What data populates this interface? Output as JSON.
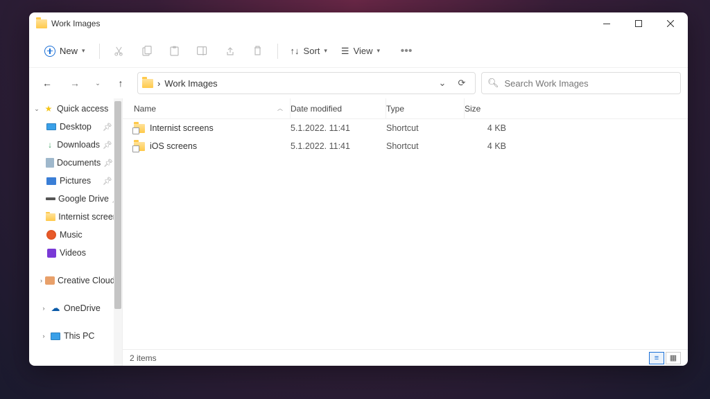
{
  "window": {
    "title": "Work Images"
  },
  "toolbar": {
    "new_label": "New",
    "sort_label": "Sort",
    "view_label": "View"
  },
  "address": {
    "path": "Work Images",
    "sep": "›"
  },
  "search": {
    "placeholder": "Search Work Images"
  },
  "sidebar": {
    "quick_access": "Quick access",
    "items": [
      {
        "label": "Desktop",
        "pinned": true
      },
      {
        "label": "Downloads",
        "pinned": true
      },
      {
        "label": "Documents",
        "pinned": true
      },
      {
        "label": "Pictures",
        "pinned": true
      },
      {
        "label": "Google Drive",
        "pinned": true
      },
      {
        "label": "Internist screens",
        "pinned": false
      },
      {
        "label": "Music",
        "pinned": false
      },
      {
        "label": "Videos",
        "pinned": false
      }
    ],
    "creative_cloud": "Creative Cloud Files",
    "onedrive": "OneDrive",
    "this_pc": "This PC"
  },
  "columns": {
    "name": "Name",
    "date": "Date modified",
    "type": "Type",
    "size": "Size"
  },
  "rows": [
    {
      "name": "Internist screens",
      "date": "5.1.2022. 11:41",
      "type": "Shortcut",
      "size": "4 KB"
    },
    {
      "name": "iOS screens",
      "date": "5.1.2022. 11:41",
      "type": "Shortcut",
      "size": "4 KB"
    }
  ],
  "status": {
    "count": "2 items"
  }
}
